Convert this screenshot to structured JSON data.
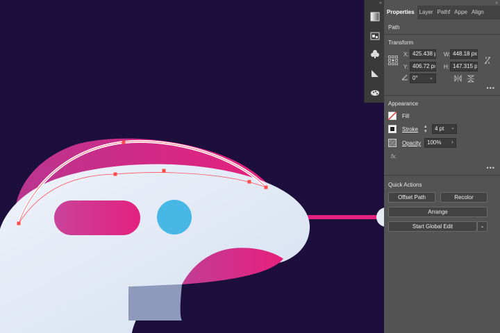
{
  "panel": {
    "tabs": [
      "Properties",
      "Layer",
      "Pathf",
      "Appe",
      "Align"
    ],
    "object_type": "Path",
    "transform": {
      "title": "Transform",
      "x_label": "X:",
      "x_value": "425.438 p",
      "w_label": "W:",
      "w_value": "448.18 px",
      "y_label": "Y:",
      "y_value": "406.72 px",
      "h_label": "H:",
      "h_value": "147.315 p",
      "angle_value": "0°"
    },
    "appearance": {
      "title": "Appearance",
      "fill_label": "Fill",
      "stroke_label": "Stroke",
      "stroke_value": "4 pt",
      "opacity_label": "Opacity",
      "opacity_value": "100%",
      "fx_label": "fx."
    },
    "quick_actions": {
      "title": "Quick Actions",
      "offset_path": "Offset Path",
      "recolor": "Recolor",
      "arrange": "Arrange",
      "global_edit": "Start Global Edit"
    }
  },
  "icons": [
    "gradient-icon",
    "image-trace-icon",
    "symbols-icon",
    "asset-export-icon",
    "color-theme-icon"
  ],
  "colors": {
    "canvas_bg": "#1c0f3c",
    "body_light": "#e2e9f5",
    "magenta": "#e0237e",
    "cyan": "#47b8e6",
    "selection": "#ff4a4a",
    "panel_bg": "#535353"
  }
}
